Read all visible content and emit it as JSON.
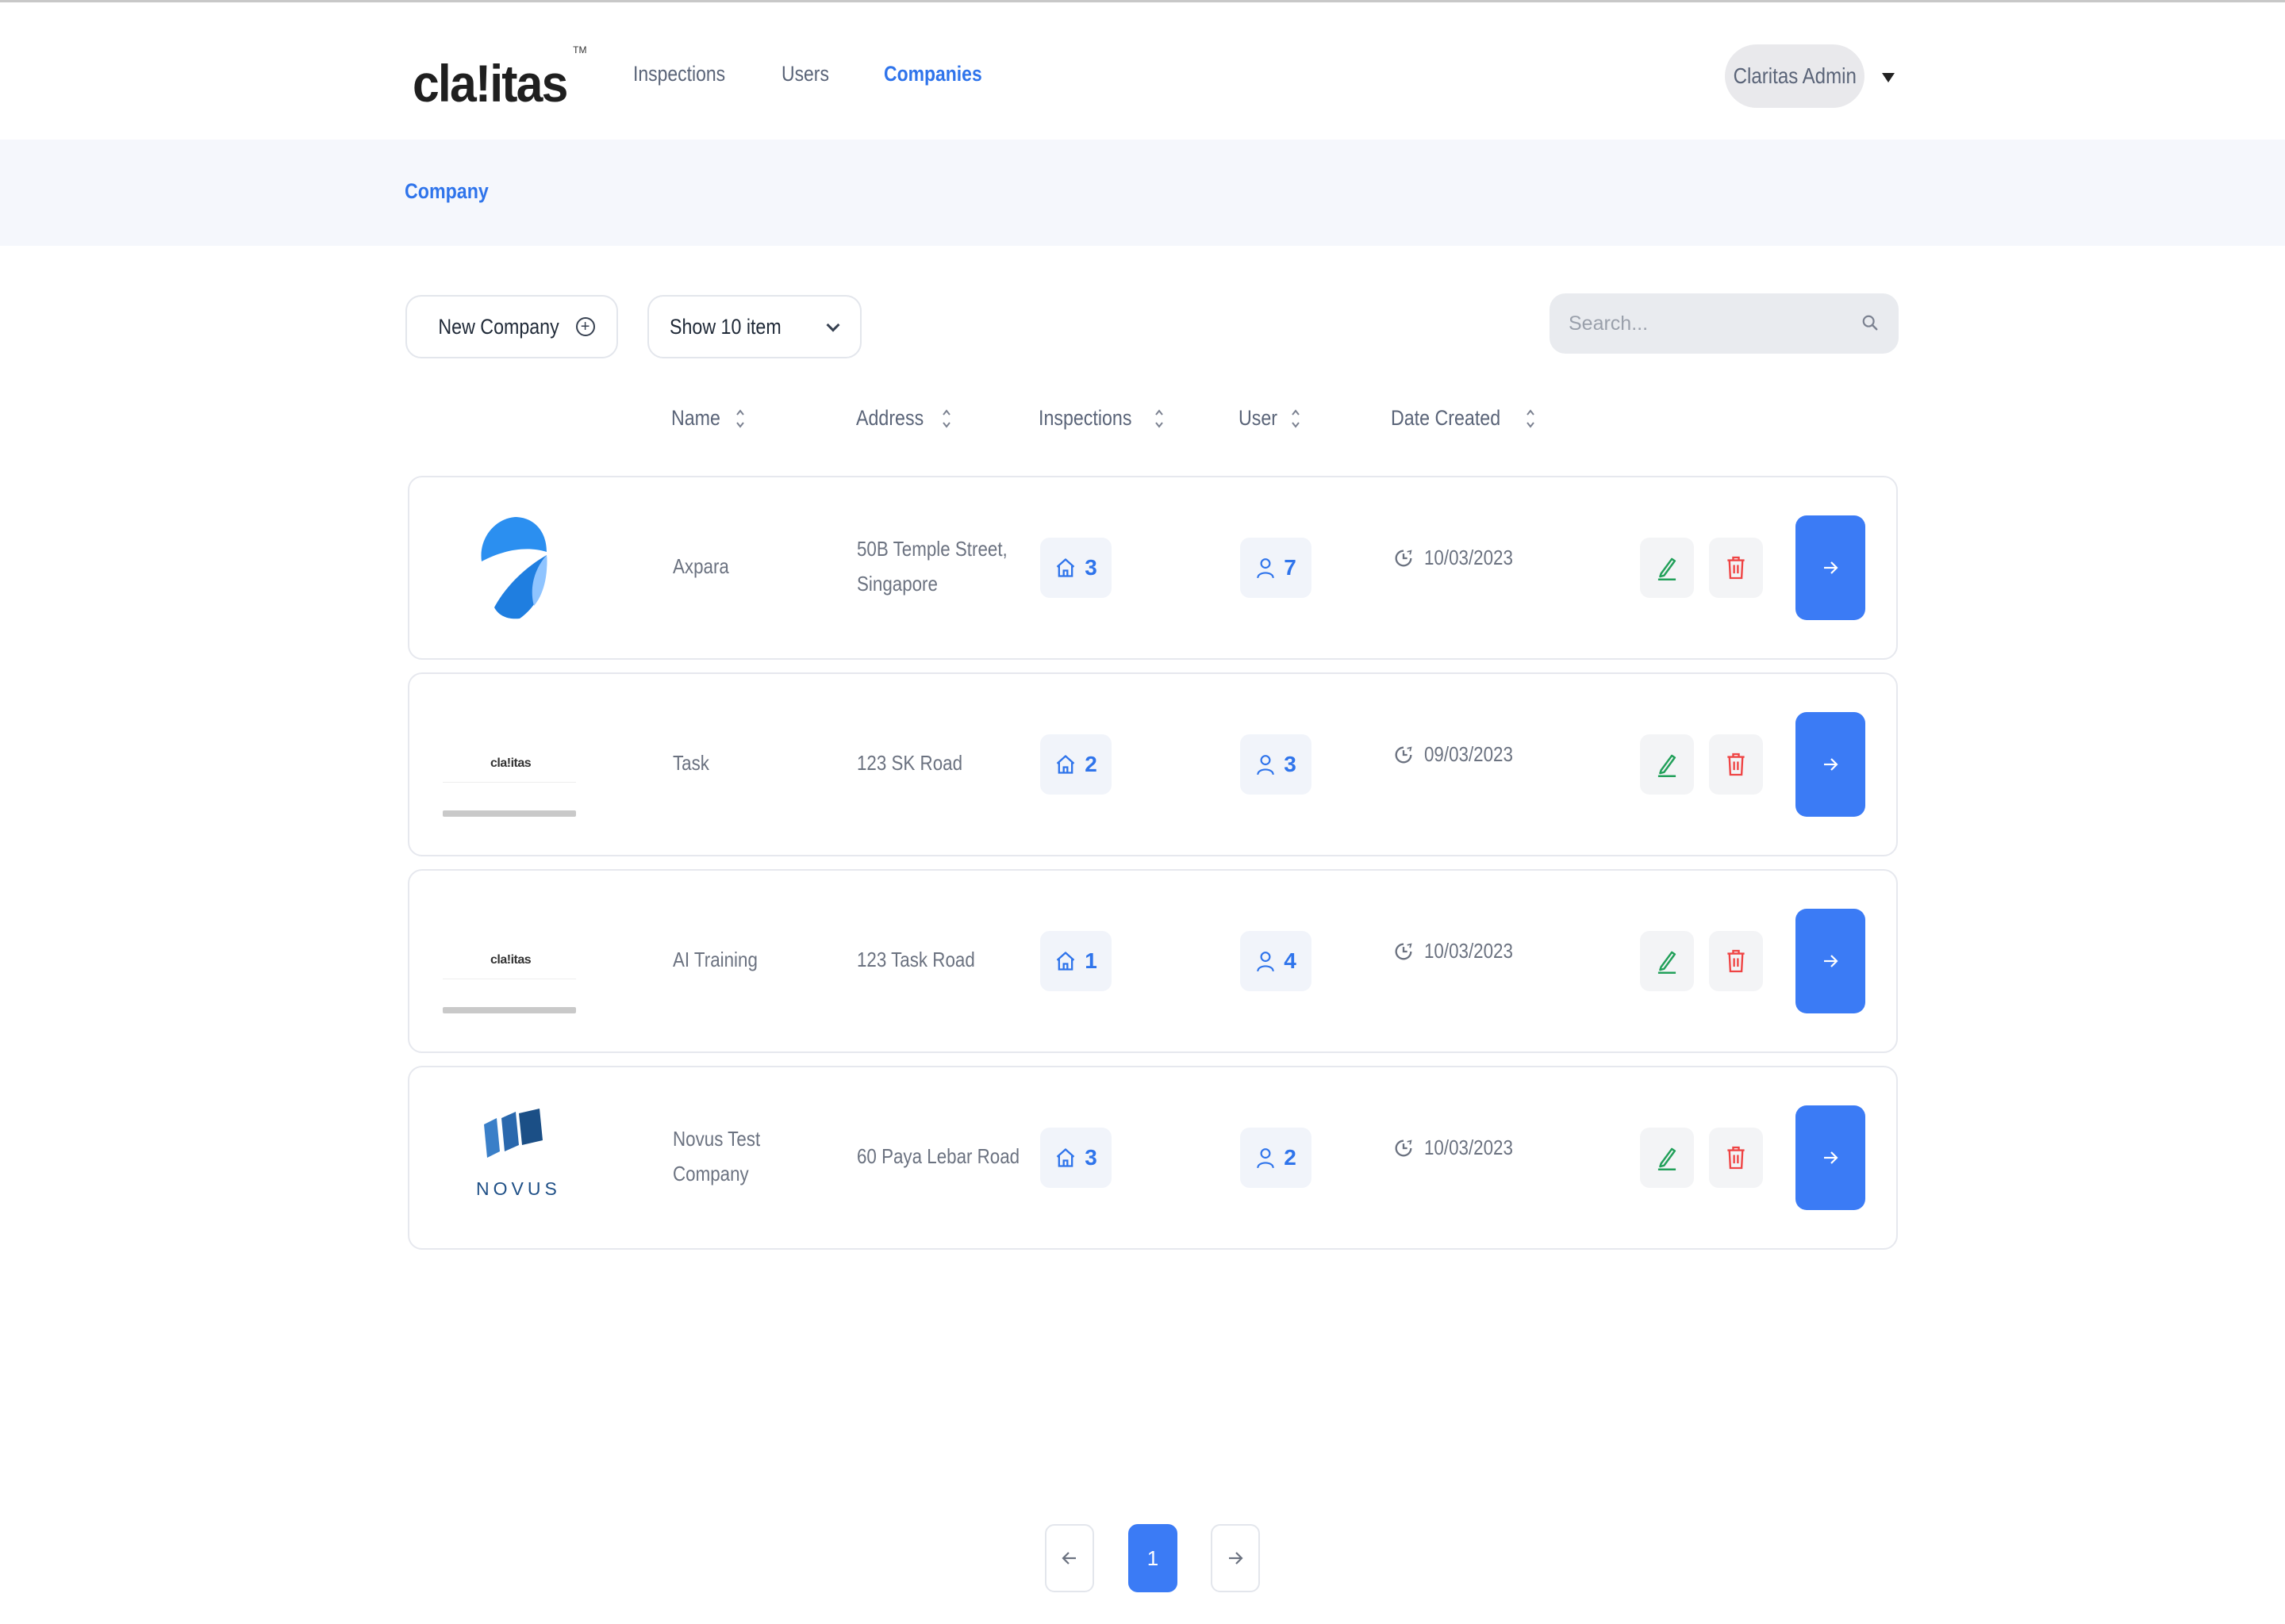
{
  "app": {
    "logo_text": "cla!itas",
    "logo_tm": "TM"
  },
  "nav": {
    "items": [
      "Inspections",
      "Users",
      "Companies"
    ],
    "active": "Companies"
  },
  "user": {
    "name": "Claritas Admin"
  },
  "breadcrumb": "Company",
  "toolbar": {
    "new_label": "New Company",
    "show_label": "Show 10 item",
    "search_placeholder": "Search..."
  },
  "columns": [
    "Name",
    "Address",
    "Inspections",
    "User",
    "Date Created"
  ],
  "companies": [
    {
      "logo": "axpara-logo",
      "name": "Axpara",
      "address": "50B Temple Street,\nSingapore",
      "inspections": "3",
      "users": "7",
      "date": "10/03/2023"
    },
    {
      "logo": "claritas-logo",
      "logo_text": "cla!itas",
      "name": "Task",
      "address": "123 SK Road",
      "inspections": "2",
      "users": "3",
      "date": "09/03/2023"
    },
    {
      "logo": "claritas-logo",
      "logo_text": "cla!itas",
      "name": "AI Training",
      "address": "123 Task Road",
      "inspections": "1",
      "users": "4",
      "date": "10/03/2023"
    },
    {
      "logo": "novus-logo",
      "logo_text": "NOVUS",
      "name": "Novus Test\nCompany",
      "address": "60 Paya Lebar Road",
      "inspections": "3",
      "users": "2",
      "date": "10/03/2023"
    }
  ],
  "pagination": {
    "current": "1"
  },
  "colors": {
    "accent": "#3b7bf5",
    "edit": "#22a05a",
    "delete": "#ef4444",
    "muted": "#6b7280"
  },
  "icons": {
    "inspections": "home-icon",
    "users": "user-icon",
    "date": "clock-icon",
    "edit": "pencil-icon",
    "delete": "trash-icon",
    "open": "arrow-right-icon"
  }
}
